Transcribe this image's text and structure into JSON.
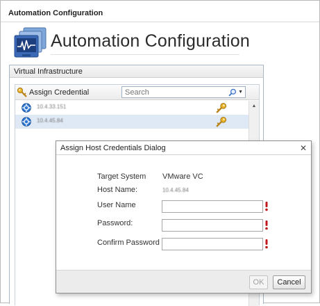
{
  "window": {
    "title": "Automation Configuration"
  },
  "page": {
    "title": "Automation Configuration",
    "icon": "monitor-waveform-icon"
  },
  "panel": {
    "title": "Virtual Infrastructure",
    "toolbar": {
      "assign_label": "Assign Credential",
      "assign_icon": "key-icon",
      "search_placeholder": "Search",
      "search_icon": "magnifier-icon"
    },
    "rows": [
      {
        "host": "10.4.33.151",
        "selected": false
      },
      {
        "host": "10.4.45.84",
        "selected": true
      }
    ]
  },
  "dialog": {
    "title": "Assign Host Credentials Dialog",
    "close_glyph": "✕",
    "target_system_label": "Target System",
    "target_system_value": "VMware VC",
    "host_name_label": "Host Name:",
    "host_name_value": "10.4.45.84",
    "user_name_label": "User Name",
    "user_name_value": "",
    "password_label": "Password:",
    "password_value": "",
    "confirm_password_label": "Confirm Password",
    "confirm_password_value": "",
    "ok_label": "OK",
    "cancel_label": "Cancel"
  },
  "colors": {
    "selected_row": "#dfe9f5",
    "required_marker": "#c0161c",
    "key": "#e0a81c"
  }
}
